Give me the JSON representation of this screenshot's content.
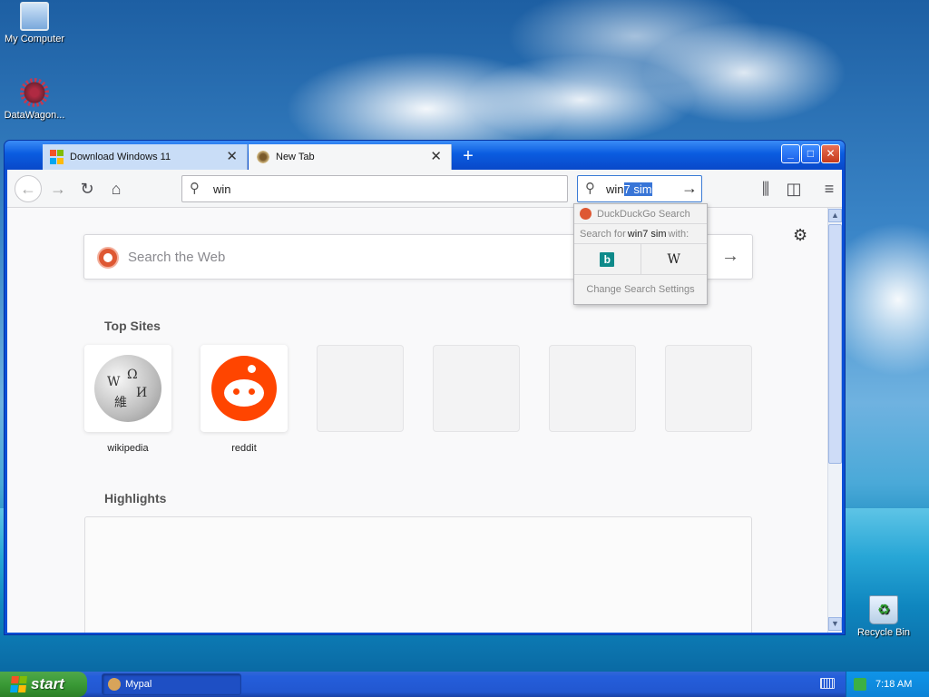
{
  "desktop": {
    "icons": [
      {
        "label": "My Computer"
      },
      {
        "label": "DataWagon..."
      },
      {
        "label": "Recycle Bin"
      }
    ]
  },
  "browser": {
    "tabs": [
      {
        "label": "Download Windows 11",
        "icon": "windows-logo-icon"
      },
      {
        "label": "New Tab",
        "icon": "mypal-icon"
      }
    ],
    "url_value": "win",
    "search": {
      "typed": "win",
      "selected": "7 sim"
    },
    "popup": {
      "engine_title": "DuckDuckGo Search",
      "search_for_prefix": "Search for",
      "query": "win7 sim",
      "search_for_suffix": "with:",
      "engines": [
        "bing",
        "W"
      ],
      "settings": "Change Search Settings"
    },
    "newtab": {
      "search_placeholder": "Search the Web",
      "top_sites_title": "Top Sites",
      "sites": [
        {
          "label": "wikipedia"
        },
        {
          "label": "reddit"
        }
      ],
      "highlights_title": "Highlights"
    }
  },
  "taskbar": {
    "start_label": "start",
    "task_label": "Mypal",
    "clock": "7:18 AM"
  },
  "colors": {
    "xp_blue": "#0a5ce0",
    "start_green": "#3a9a36",
    "reddit": "#ff4500",
    "ddg": "#de5833"
  }
}
